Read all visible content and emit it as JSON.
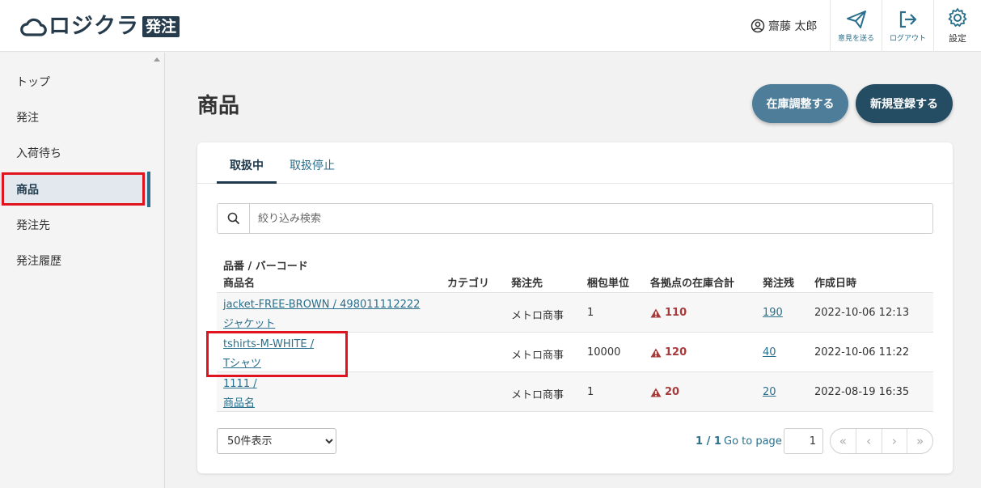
{
  "app": {
    "logo_text": "ロジクラ",
    "logo_badge": "発注"
  },
  "header": {
    "user_name": "齋藤 太郎",
    "feedback_label": "意見を送る",
    "logout_label": "ログアウト",
    "settings_label": "設定"
  },
  "sidebar": {
    "items": [
      {
        "label": "トップ"
      },
      {
        "label": "発注"
      },
      {
        "label": "入荷待ち"
      },
      {
        "label": "商品"
      },
      {
        "label": "発注先"
      },
      {
        "label": "発注履歴"
      }
    ]
  },
  "main": {
    "title": "商品",
    "stock_adjust_label": "在庫調整する",
    "new_register_label": "新規登録する",
    "tabs": [
      {
        "label": "取扱中"
      },
      {
        "label": "取扱停止"
      }
    ],
    "search_placeholder": "絞り込み検索",
    "table": {
      "headers": {
        "code_line1": "品番 / バーコード",
        "code_line2": "商品名",
        "category": "カテゴリ",
        "supplier": "発注先",
        "pack_unit": "梱包単位",
        "stock_total": "各拠点の在庫合計",
        "order_remaining": "発注残",
        "created_at": "作成日時"
      },
      "rows": [
        {
          "code": "jacket-FREE-BROWN / 498011112222",
          "name": "ジャケット",
          "category": "",
          "supplier": "メトロ商事",
          "pack_unit": "1",
          "stock_total": "110",
          "order_remaining": "190",
          "created_at": "2022-10-06 12:13"
        },
        {
          "code": "tshirts-M-WHITE /",
          "name": "Tシャツ",
          "category": "",
          "supplier": "メトロ商事",
          "pack_unit": "10000",
          "stock_total": "120",
          "order_remaining": "40",
          "created_at": "2022-10-06 11:22"
        },
        {
          "code": "1111 /",
          "name": "商品名",
          "category": "",
          "supplier": "メトロ商事",
          "pack_unit": "1",
          "stock_total": "20",
          "order_remaining": "20",
          "created_at": "2022-08-19 16:35"
        }
      ]
    },
    "pagination": {
      "per_page": "50件表示",
      "count": "1 / 1",
      "goto_label": "Go to page",
      "page_value": "1"
    }
  }
}
